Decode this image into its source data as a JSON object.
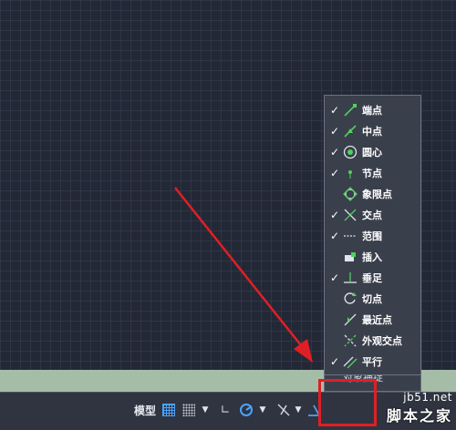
{
  "menu": {
    "items": [
      {
        "label": "端点",
        "checked": true,
        "icon": "endpoint-icon"
      },
      {
        "label": "中点",
        "checked": true,
        "icon": "midpoint-icon"
      },
      {
        "label": "圆心",
        "checked": true,
        "icon": "center-icon"
      },
      {
        "label": "节点",
        "checked": true,
        "icon": "node-icon"
      },
      {
        "label": "象限点",
        "checked": false,
        "icon": "quadrant-icon"
      },
      {
        "label": "交点",
        "checked": true,
        "icon": "intersection-icon"
      },
      {
        "label": "范围",
        "checked": true,
        "icon": "extension-icon"
      },
      {
        "label": "插入",
        "checked": false,
        "icon": "insert-icon"
      },
      {
        "label": "垂足",
        "checked": true,
        "icon": "perpendicular-icon"
      },
      {
        "label": "切点",
        "checked": false,
        "icon": "tangent-icon"
      },
      {
        "label": "最近点",
        "checked": false,
        "icon": "nearest-icon"
      },
      {
        "label": "外观交点",
        "checked": false,
        "icon": "apparent-intersection-icon"
      },
      {
        "label": "平行",
        "checked": true,
        "icon": "parallel-icon"
      }
    ],
    "check_glyph": "✓",
    "settings_partial": "对象捕捉"
  },
  "statusbar": {
    "model_label": "模型",
    "dropdown_glyph": "▼"
  },
  "watermark": {
    "site": "jb51.net",
    "name": "脚本之家"
  },
  "colors": {
    "annotation_red": "#e01f24",
    "accent_green": "#4fd25a",
    "accent_blue": "#4aa3ff"
  }
}
